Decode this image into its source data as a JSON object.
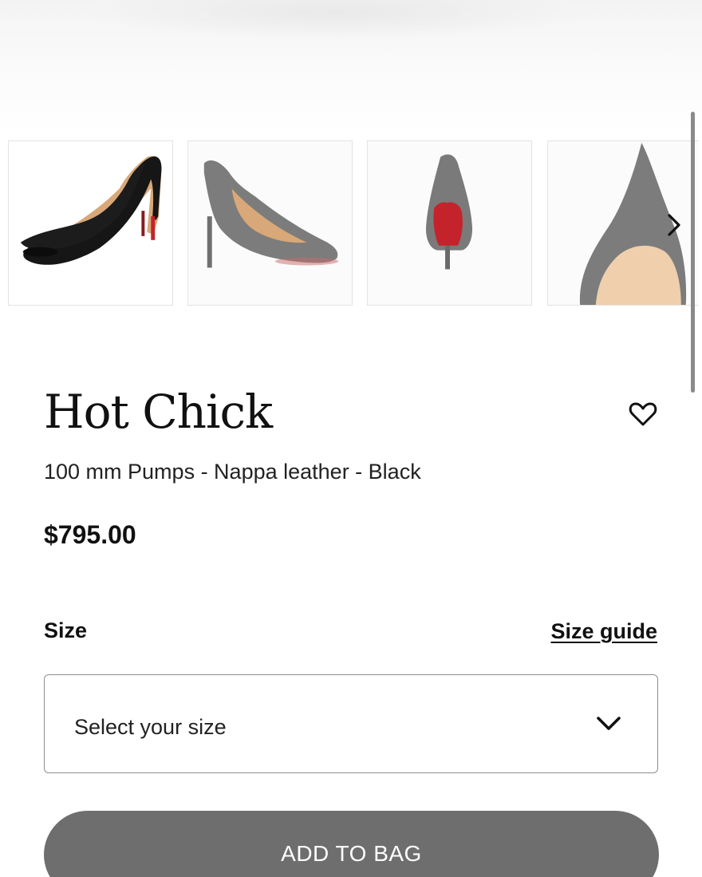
{
  "gallery": {
    "thumbnails": [
      {
        "alt": "Hot Chick pump side view"
      },
      {
        "alt": "Hot Chick pump profile"
      },
      {
        "alt": "Hot Chick pump back view"
      },
      {
        "alt": "Hot Chick pump toe detail"
      }
    ],
    "next_icon": "chevron-right-icon"
  },
  "product": {
    "name": "Hot Chick",
    "description": "100 mm Pumps - Nappa leather - Black",
    "price": "$795.00",
    "wishlist_icon": "heart-icon"
  },
  "size": {
    "label": "Size",
    "guide_label": "Size guide",
    "select_placeholder": "Select your size",
    "dropdown_icon": "chevron-down-icon"
  },
  "actions": {
    "add_to_bag_label": "ADD TO BAG"
  },
  "colors": {
    "button_bg": "#6e6e6e",
    "sole_red": "#c4232b",
    "text": "#111111"
  }
}
